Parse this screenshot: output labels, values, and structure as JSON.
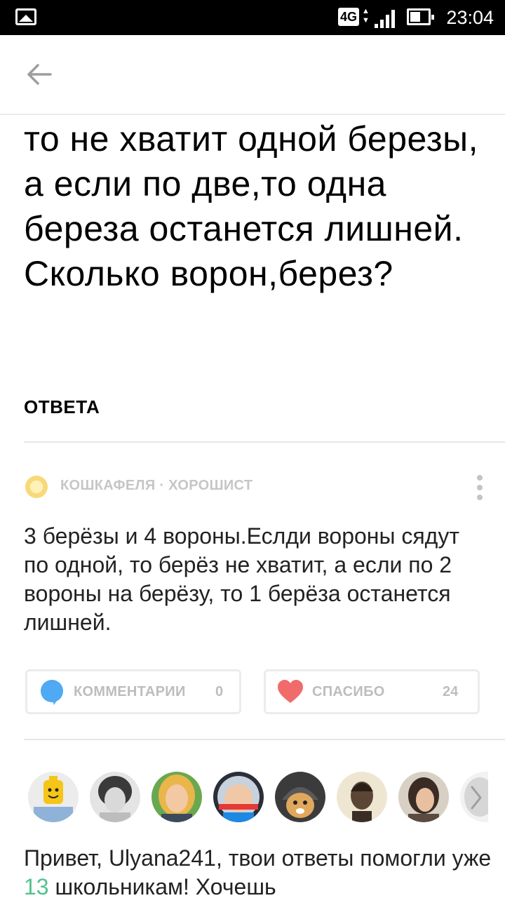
{
  "status_bar": {
    "network": "4G",
    "time": "23:04",
    "icons": [
      "gallery-icon",
      "network-arrows-icon",
      "signal-icon",
      "battery-icon"
    ]
  },
  "header": {
    "back_icon": "arrow-left-icon"
  },
  "question": {
    "text": "то не хватит одной березы, а если по две,то одна береза останется лишней. Сколько ворон,берез?"
  },
  "answers_section": {
    "heading": "ОТВЕТА"
  },
  "answer": {
    "author": "КОШКАФЕЛЯ",
    "separator": "·",
    "rank": "ХОРОШИСТ",
    "text": "3 берёзы и 4 вороны.Еслди вороны сядут по одной, то берёз не хватит, а если по 2 вороны на берёзу, то 1 берёза останется лишней.",
    "comments_label": "КОММЕНТАРИИ",
    "comments_count": "0",
    "thanks_label": "СПАСИБО",
    "thanks_count": "24"
  },
  "colors": {
    "accent_blue": "#4fa9f5",
    "thanks_red": "#f26b6b",
    "counter_green": "#54c28f",
    "muted_gray": "#bdbdbd"
  },
  "promo": {
    "prefix": "Привет, Ulyana241, твои ответы помогли уже ",
    "count": "13",
    "suffix": " школьникам! Хочешь"
  }
}
